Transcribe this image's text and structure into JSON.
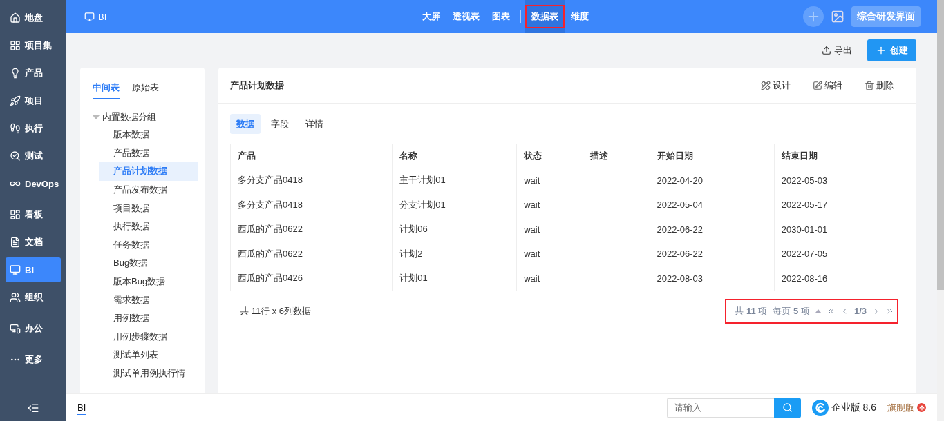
{
  "sidebar": {
    "groups": [
      {
        "items": [
          {
            "label": "地盘",
            "selected": false
          },
          {
            "label": "项目集",
            "selected": false
          },
          {
            "label": "产品",
            "selected": false
          },
          {
            "label": "项目",
            "selected": false
          },
          {
            "label": "执行",
            "selected": false
          },
          {
            "label": "测试",
            "selected": false
          },
          {
            "label": "DevOps",
            "selected": false
          }
        ]
      },
      {
        "items": [
          {
            "label": "看板",
            "selected": false
          },
          {
            "label": "文档",
            "selected": false
          },
          {
            "label": "BI",
            "selected": true
          },
          {
            "label": "组织",
            "selected": false
          }
        ]
      },
      {
        "items": [
          {
            "label": "办公",
            "selected": false
          }
        ]
      },
      {
        "items": [
          {
            "label": "更多",
            "selected": false
          }
        ]
      }
    ]
  },
  "topbar": {
    "title": "BI",
    "nav": [
      {
        "label": "大屏",
        "selected": false,
        "highlighted": false
      },
      {
        "label": "透视表",
        "selected": false,
        "highlighted": false
      },
      {
        "label": "图表",
        "selected": false,
        "highlighted": false
      },
      {
        "label": "数据表",
        "selected": true,
        "highlighted": true
      },
      {
        "label": "维度",
        "selected": false,
        "highlighted": false
      }
    ],
    "switch_button": "综合研发界面"
  },
  "toolbar": {
    "export": "导出",
    "create": "创建"
  },
  "left_panel": {
    "tabs": [
      {
        "label": "中间表",
        "selected": true
      },
      {
        "label": "原始表",
        "selected": false
      }
    ],
    "tree": {
      "label": "内置数据分组",
      "expanded": true,
      "children": [
        {
          "label": "版本数据",
          "selected": false
        },
        {
          "label": "产品数据",
          "selected": false
        },
        {
          "label": "产品计划数据",
          "selected": true
        },
        {
          "label": "产品发布数据",
          "selected": false
        },
        {
          "label": "项目数据",
          "selected": false
        },
        {
          "label": "执行数据",
          "selected": false
        },
        {
          "label": "任务数据",
          "selected": false
        },
        {
          "label": "Bug数据",
          "selected": false
        },
        {
          "label": "版本Bug数据",
          "selected": false
        },
        {
          "label": "需求数据",
          "selected": false
        },
        {
          "label": "用例数据",
          "selected": false
        },
        {
          "label": "用例步骤数据",
          "selected": false
        },
        {
          "label": "测试单列表",
          "selected": false
        },
        {
          "label": "测试单用例执行情",
          "selected": false
        }
      ]
    }
  },
  "card": {
    "title": "产品计划数据",
    "actions": [
      "设计",
      "编辑",
      "删除"
    ],
    "tabs": [
      {
        "label": "数据",
        "selected": true
      },
      {
        "label": "字段",
        "selected": false
      },
      {
        "label": "详情",
        "selected": false
      }
    ],
    "table": {
      "columns": [
        "产品",
        "名称",
        "状态",
        "描述",
        "开始日期",
        "结束日期"
      ],
      "rows": [
        [
          "多分支产品0418",
          "主干计划01",
          "wait",
          "",
          "2022-04-20",
          "2022-05-03"
        ],
        [
          "多分支产品0418",
          "分支计划01",
          "wait",
          "",
          "2022-05-04",
          "2022-05-17"
        ],
        [
          "西瓜的产品0622",
          "计划06",
          "wait",
          "",
          "2022-06-22",
          "2030-01-01"
        ],
        [
          "西瓜的产品0622",
          "计划2",
          "wait",
          "",
          "2022-06-22",
          "2022-07-05"
        ],
        [
          "西瓜的产品0426",
          "计划01",
          "wait",
          "",
          "2022-08-03",
          "2022-08-16"
        ]
      ]
    },
    "summary": "共 11行 x 6列数据",
    "pager": {
      "highlighted": true,
      "total": "共 **11** 项",
      "per_page": "每页 **5** 项",
      "page": "1/3"
    }
  },
  "bottom_bar": {
    "tab": "BI",
    "search": {
      "placeholder": "请输入"
    },
    "version": "企业版 8.6",
    "upgrade": "旗舰版"
  }
}
